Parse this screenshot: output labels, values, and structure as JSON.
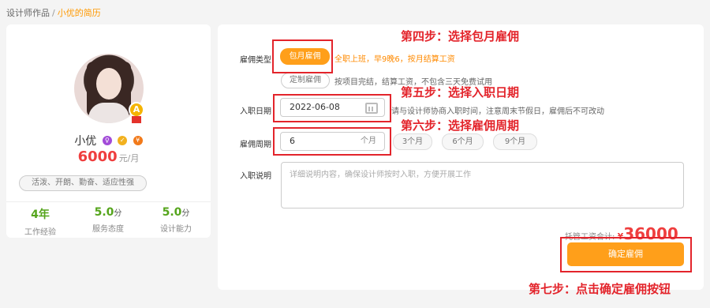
{
  "breadcrumb": {
    "parent": "设计师作品",
    "separator": "/",
    "current": "小优的简历"
  },
  "profile": {
    "name": "小优",
    "badge_letter": "A",
    "price": "6000",
    "price_unit": "元/月",
    "tags": "活泼、开朗、勤奋、适应性强",
    "stats": [
      {
        "value": "4年",
        "unit": "",
        "label": "工作经验"
      },
      {
        "value": "5.0",
        "unit": "分",
        "label": "服务态度"
      },
      {
        "value": "5.0",
        "unit": "分",
        "label": "设计能力"
      }
    ]
  },
  "form": {
    "employ_type": {
      "label": "雇佣类型",
      "option_monthly": "包月雇佣",
      "monthly_note": "全职上班，早9晚6，按月结算工资",
      "option_custom": "定制雇佣",
      "custom_note": "按项目完结，结算工资，不包含三天免费试用"
    },
    "start_date": {
      "label": "入职日期",
      "value": "2022-06-08",
      "note": "请与设计师协商入职时间，注意周末节假日，雇佣后不可改动"
    },
    "period": {
      "label": "雇佣周期",
      "value": "6",
      "unit": "个月",
      "options": [
        "3个月",
        "6个月",
        "9个月"
      ]
    },
    "description": {
      "label": "入职说明",
      "placeholder": "详细说明内容，确保设计师按时入职，方便开展工作"
    },
    "total_label": "托管工资合计:",
    "total_currency": "¥",
    "total_amount": "36000",
    "confirm_label": "确定雇佣"
  },
  "steps": {
    "step4": "第四步：选择包月雇佣",
    "step5": "第五步：选择入职日期",
    "step6": "第六步：选择雇佣周期",
    "step7": "第七步：点击确定雇佣按钮"
  },
  "colors": {
    "accent": "#ff9f1a",
    "price": "#ef3e3e",
    "annotation": "#e3242b",
    "stat": "#55a51c"
  }
}
